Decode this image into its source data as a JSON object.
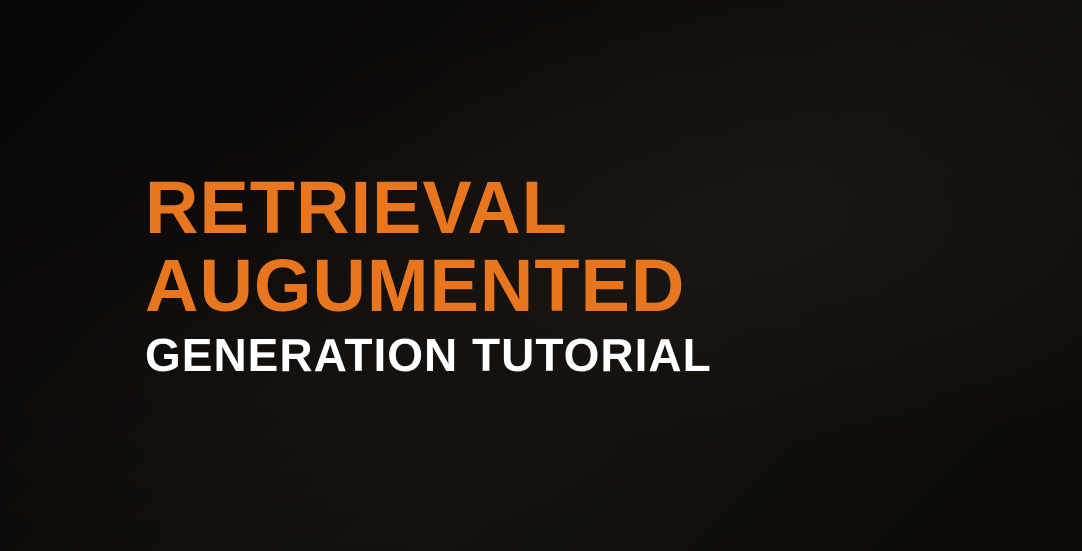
{
  "hero": {
    "title_line_1": "RETRIEVAL",
    "title_line_2": "AUGUMENTED",
    "subtitle": "GENERATION TUTORIAL"
  },
  "colors": {
    "accent": "#e8761f",
    "text_primary": "#ffffff"
  }
}
